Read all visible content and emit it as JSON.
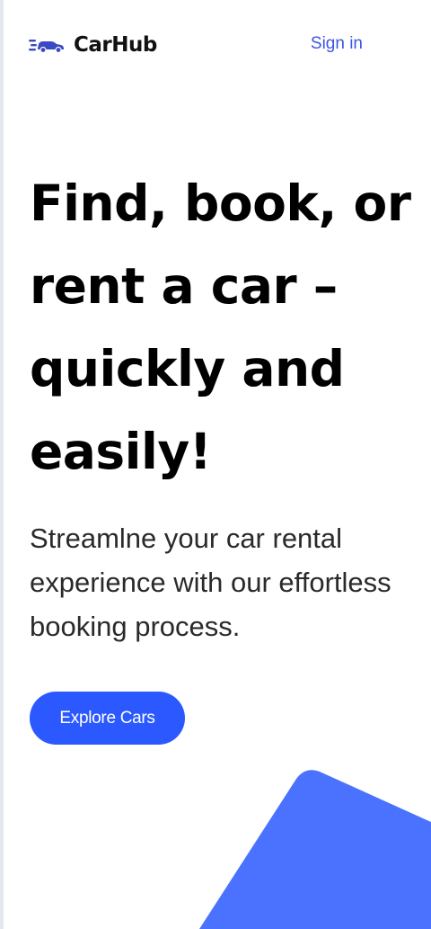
{
  "header": {
    "logo_text": "CarHub",
    "logo_icon": "car-speed-icon",
    "signin_label": "Sign in"
  },
  "hero": {
    "title": "Find, book, or rent a car – quickly and easily!",
    "subtitle": "Streamlne your car rental experience with our effortless booking process.",
    "cta_label": "Explore Cars"
  },
  "colors": {
    "accent": "#2b59ff",
    "link": "#3b55e6",
    "shape": "#4a72ff"
  }
}
